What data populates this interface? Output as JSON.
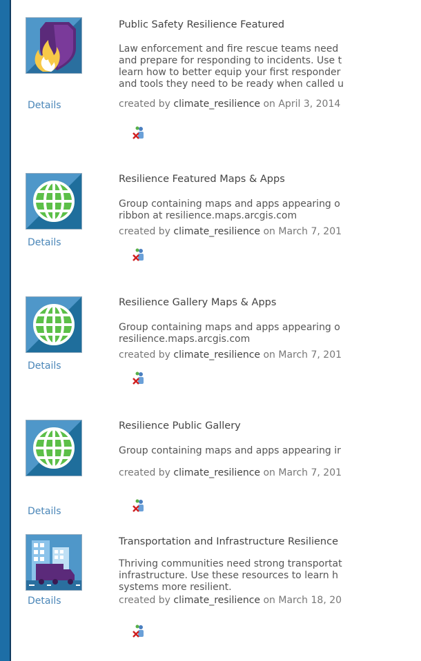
{
  "groups": [
    {
      "title": "Public Safety Resilience Featured",
      "description": "Law enforcement and fire rescue teams need\nand prepare for responding to incidents. Use t\nlearn how to better equip your first responder\nand tools they need to be ready when called u",
      "created_prefix": "created by",
      "owner": "climate_resilience",
      "date_text": "on April 3, 2014",
      "details_label": "Details",
      "thumb_icon": "shield-flame-icon"
    },
    {
      "title": "Resilience Featured Maps & Apps",
      "description": "Group containing maps and apps appearing o\nribbon at resilience.maps.arcgis.com",
      "created_prefix": "created by",
      "owner": "climate_resilience",
      "date_text": "on March 7, 201",
      "details_label": "Details",
      "thumb_icon": "globe-icon"
    },
    {
      "title": "Resilience Gallery Maps & Apps",
      "description": "Group containing maps and apps appearing o\nresilience.maps.arcgis.com",
      "created_prefix": "created by",
      "owner": "climate_resilience",
      "date_text": "on March 7, 201",
      "details_label": "Details",
      "thumb_icon": "globe-icon"
    },
    {
      "title": "Resilience Public Gallery",
      "description": "Group containing maps and apps appearing ir",
      "created_prefix": "created by",
      "owner": "climate_resilience",
      "date_text": "on March 7, 201",
      "details_label": "Details",
      "thumb_icon": "globe-icon"
    },
    {
      "title": "Transportation and Infrastructure Resilience",
      "description": "Thriving communities need strong transportat\ninfrastructure. Use these resources to learn h\nsystems more resilient.",
      "created_prefix": "created by",
      "owner": "climate_resilience",
      "date_text": "on March 18, 20",
      "details_label": "Details",
      "thumb_icon": "truck-building-icon"
    }
  ],
  "colors": {
    "page_bg": "#1d6ea6",
    "globe_green": "#5cbf48",
    "tile_blue": "#1f6e9c",
    "shield_purple": "#5b2a7a",
    "link_blue": "#4a86b8"
  }
}
